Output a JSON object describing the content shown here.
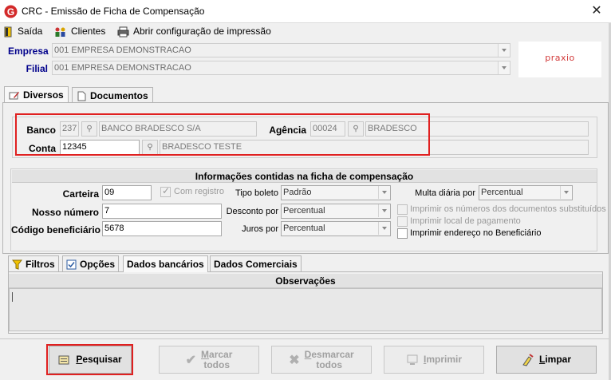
{
  "window": {
    "title": "CRC - Emissão de Ficha de Compensação",
    "close_glyph": "✕"
  },
  "menu": {
    "items": [
      {
        "label": "Saída",
        "icon": "exit-icon"
      },
      {
        "label": "Clientes",
        "icon": "clients-icon"
      },
      {
        "label": "Abrir configuração de impressão",
        "icon": "printer-icon"
      }
    ]
  },
  "company": {
    "empresa_label": "Empresa",
    "empresa_value": "001 EMPRESA DEMONSTRACAO",
    "filial_label": "Filial",
    "filial_value": "001 EMPRESA DEMONSTRACAO",
    "logo_text": "praxio"
  },
  "top_tabs": [
    {
      "label": "Diversos",
      "icon": "edit-icon",
      "active": true
    },
    {
      "label": "Documentos",
      "icon": "document-icon",
      "active": false
    }
  ],
  "bank": {
    "banco_label": "Banco",
    "banco_code": "237",
    "banco_name": "BANCO BRADESCO S/A",
    "agencia_label": "Agência",
    "agencia_code": "00024",
    "agencia_name": "BRADESCO",
    "conta_label": "Conta",
    "conta_code": "12345",
    "conta_name": "BRADESCO TESTE"
  },
  "info": {
    "header": "Informações contidas na ficha de compensação",
    "carteira_label": "Carteira",
    "carteira_value": "09",
    "com_registro_label": "Com registro",
    "tipo_boleto_label": "Tipo boleto",
    "tipo_boleto_value": "Padrão",
    "multa_label": "Multa diária por",
    "multa_value": "Percentual",
    "nosso_numero_label": "Nosso número",
    "nosso_numero_value": "7",
    "desconto_label": "Desconto por",
    "desconto_value": "Percentual",
    "codigo_label": "Código beneficiário",
    "codigo_value": "5678",
    "juros_label": "Juros por",
    "juros_value": "Percentual",
    "chk_numeros": "Imprimir os números dos documentos substituídos",
    "chk_local": "Imprimir local de pagamento",
    "chk_endereco": "Imprimir endereço no Beneficiário"
  },
  "bottom_tabs": [
    {
      "label": "Filtros",
      "icon": "filter-icon"
    },
    {
      "label": "Opções",
      "icon": "checkbox-icon"
    },
    {
      "label": "Dados bancários",
      "active": true
    },
    {
      "label": "Dados Comerciais"
    }
  ],
  "observacoes": {
    "header": "Observações",
    "value": ""
  },
  "buttons": {
    "pesquisar": {
      "first": "P",
      "rest": "esquisar"
    },
    "marcar": {
      "first": "M",
      "rest": "arcar",
      "line2": "todos"
    },
    "desmarcar": {
      "first": "D",
      "rest": "esmarcar",
      "line2": "todos"
    },
    "imprimir": {
      "first": "I",
      "rest": "mprimir"
    },
    "limpar": {
      "first": "L",
      "rest": "impar"
    }
  }
}
